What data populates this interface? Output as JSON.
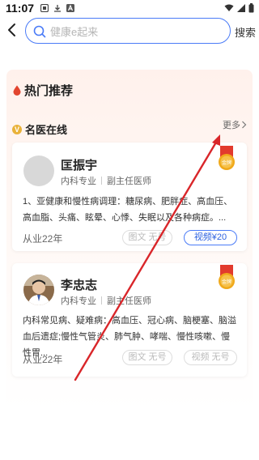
{
  "status": {
    "time": "11:07"
  },
  "header": {
    "search_placeholder": "健康e起来",
    "search_button": "搜索"
  },
  "section": {
    "title": "热门推荐",
    "subtitle": "名医在线",
    "more": "更多"
  },
  "doctors": [
    {
      "name": "匡振宇",
      "department": "内科专业",
      "title": "副主任医师",
      "description": "1、亚健康和慢性病调理：糖尿病、肥胖症、高血压、高血脂、头痛、眩晕、心悸、失眠以及各种病症。...",
      "years": "从业22年",
      "consult_text": "图文 无号",
      "consult_video": "视频¥20",
      "medal": "金牌"
    },
    {
      "name": "李忠志",
      "department": "内科专业",
      "title": "副主任医师",
      "description": "内科常见病、疑难病：高血压、冠心病、脑梗塞、脑溢血后遗症;慢性气管炎、肺气肿、哮喘、慢性咳嗽、慢性胃...",
      "years": "从业22年",
      "consult_text": "图文 无号",
      "consult_video": "视频 无号",
      "medal": "金牌"
    }
  ],
  "colors": {
    "accent": "#4a7bf7",
    "arrow": "#d9262a",
    "medal": "#f0a91b"
  }
}
